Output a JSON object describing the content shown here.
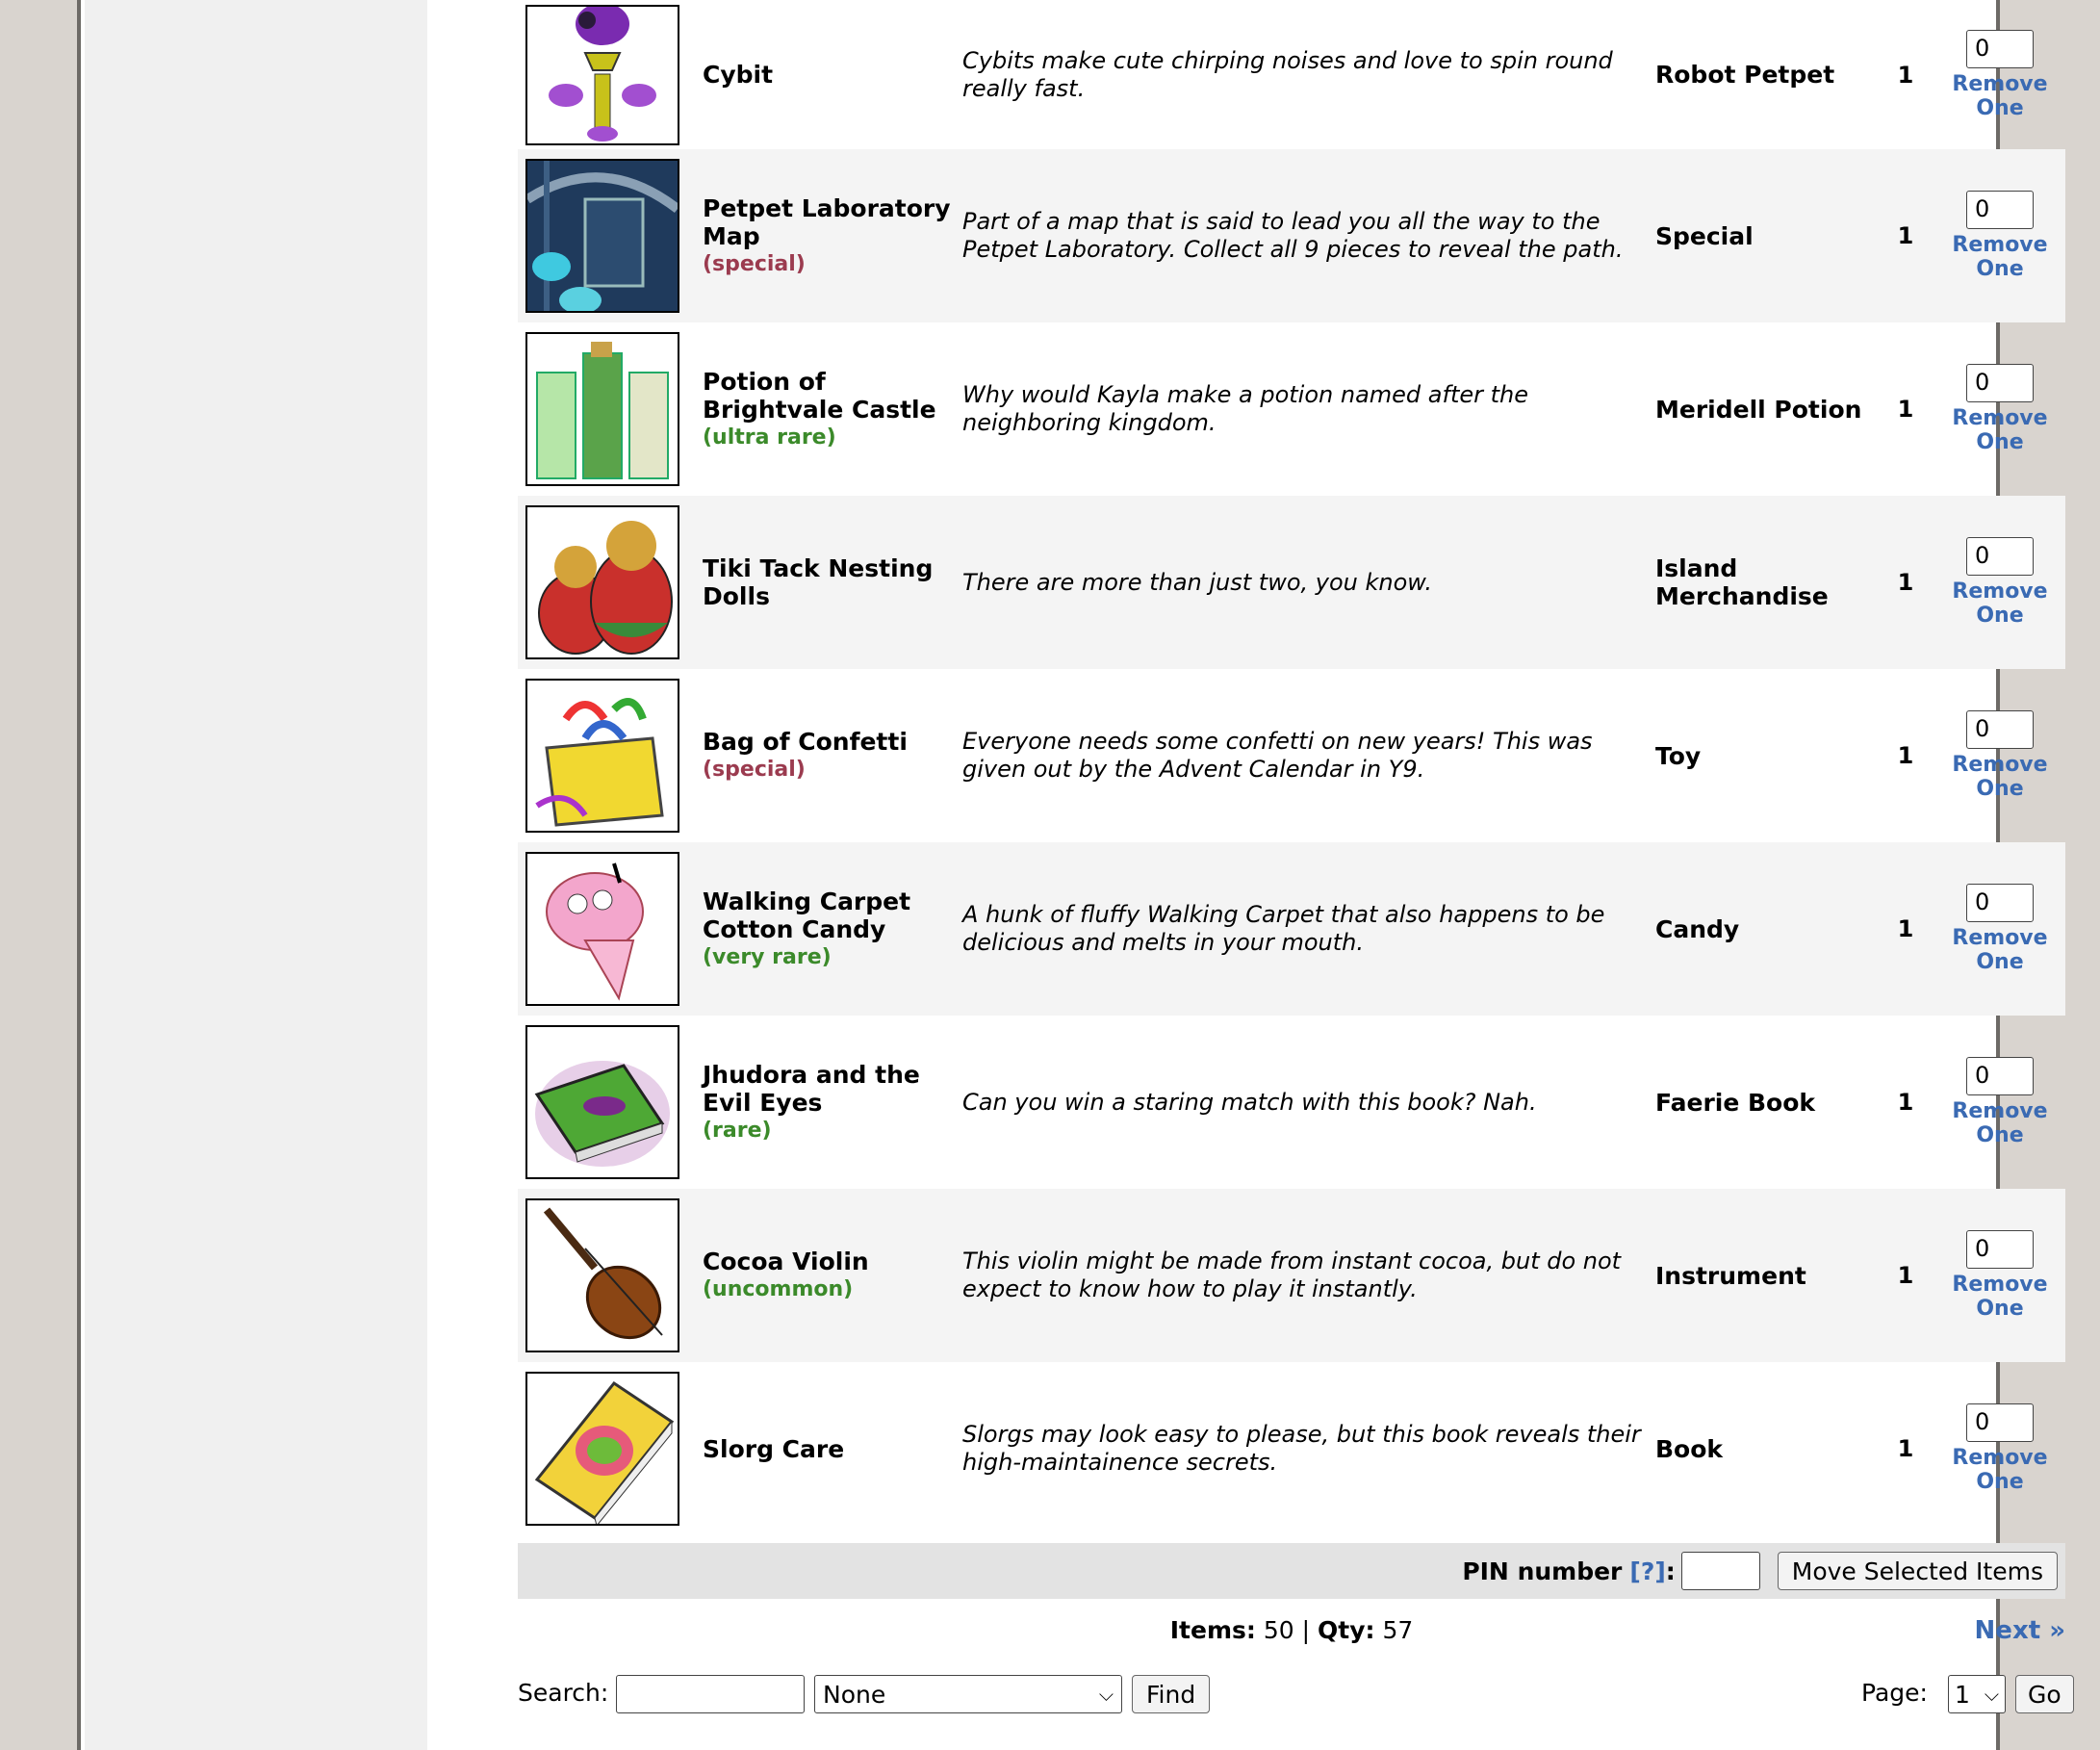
{
  "items": [
    {
      "name": "Cybit",
      "rarity": "",
      "rarity_color": "",
      "description": "Cybits make cute chirping noises and love to spin round really fast.",
      "type": "Robot Petpet",
      "qty": "1",
      "remove_value": "0",
      "remove_label": "Remove One",
      "icon": "purple-robot-petpet"
    },
    {
      "name": "Petpet Laboratory Map",
      "rarity": "(special)",
      "rarity_color": "#9b3b4f",
      "description": "Part of a map that is said to lead you all the way to the Petpet Laboratory. Collect all 9 pieces to reveal the path.",
      "type": "Special",
      "qty": "1",
      "remove_value": "0",
      "remove_label": "Remove One",
      "icon": "lab-map-piece"
    },
    {
      "name": "Potion of Brightvale Castle",
      "rarity": "(ultra rare)",
      "rarity_color": "#3b8a2a",
      "description": "Why would Kayla make a potion named after the neighboring kingdom.",
      "type": "Meridell Potion",
      "qty": "1",
      "remove_value": "0",
      "remove_label": "Remove One",
      "icon": "castle-potion"
    },
    {
      "name": "Tiki Tack Nesting Dolls",
      "rarity": "",
      "rarity_color": "",
      "description": "There are more than just two, you know.",
      "type": "Island Merchandise",
      "qty": "1",
      "remove_value": "0",
      "remove_label": "Remove One",
      "icon": "nesting-dolls"
    },
    {
      "name": "Bag of Confetti",
      "rarity": "(special)",
      "rarity_color": "#9b3b4f",
      "description": "Everyone needs some confetti on new years! This was given out by the Advent Calendar in Y9.",
      "type": "Toy",
      "qty": "1",
      "remove_value": "0",
      "remove_label": "Remove One",
      "icon": "confetti-bag"
    },
    {
      "name": "Walking Carpet Cotton Candy",
      "rarity": "(very rare)",
      "rarity_color": "#3b8a2a",
      "description": "A hunk of fluffy Walking Carpet that also happens to be delicious and melts in your mouth.",
      "type": "Candy",
      "qty": "1",
      "remove_value": "0",
      "remove_label": "Remove One",
      "icon": "cotton-candy"
    },
    {
      "name": "Jhudora and the Evil Eyes",
      "rarity": "(rare)",
      "rarity_color": "#3b8a2a",
      "description": "Can you win a staring match with this book? Nah.",
      "type": "Faerie Book",
      "qty": "1",
      "remove_value": "0",
      "remove_label": "Remove One",
      "icon": "green-book"
    },
    {
      "name": "Cocoa Violin",
      "rarity": "(uncommon)",
      "rarity_color": "#3b8a2a",
      "description": "This violin might be made from instant cocoa, but do not expect to know how to play it instantly.",
      "type": "Instrument",
      "qty": "1",
      "remove_value": "0",
      "remove_label": "Remove One",
      "icon": "violin"
    },
    {
      "name": "Slorg Care",
      "rarity": "",
      "rarity_color": "",
      "description": "Slorgs may look easy to please, but this book reveals their high-maintainence secrets.",
      "type": "Book",
      "qty": "1",
      "remove_value": "0",
      "remove_label": "Remove One",
      "icon": "yellow-book"
    }
  ],
  "pin": {
    "label": "PIN number",
    "help": "[?]",
    "colon": ":",
    "submit": "Move Selected Items"
  },
  "summary": {
    "items_label": "Items:",
    "items_value": "50",
    "sep": "|",
    "qty_label": "Qty:",
    "qty_value": "57"
  },
  "next_label": "Next »",
  "search": {
    "label": "Search:",
    "value": "",
    "filter_selected": "None",
    "find_label": "Find"
  },
  "page": {
    "label": "Page:",
    "selected": "1",
    "go_label": "Go"
  }
}
